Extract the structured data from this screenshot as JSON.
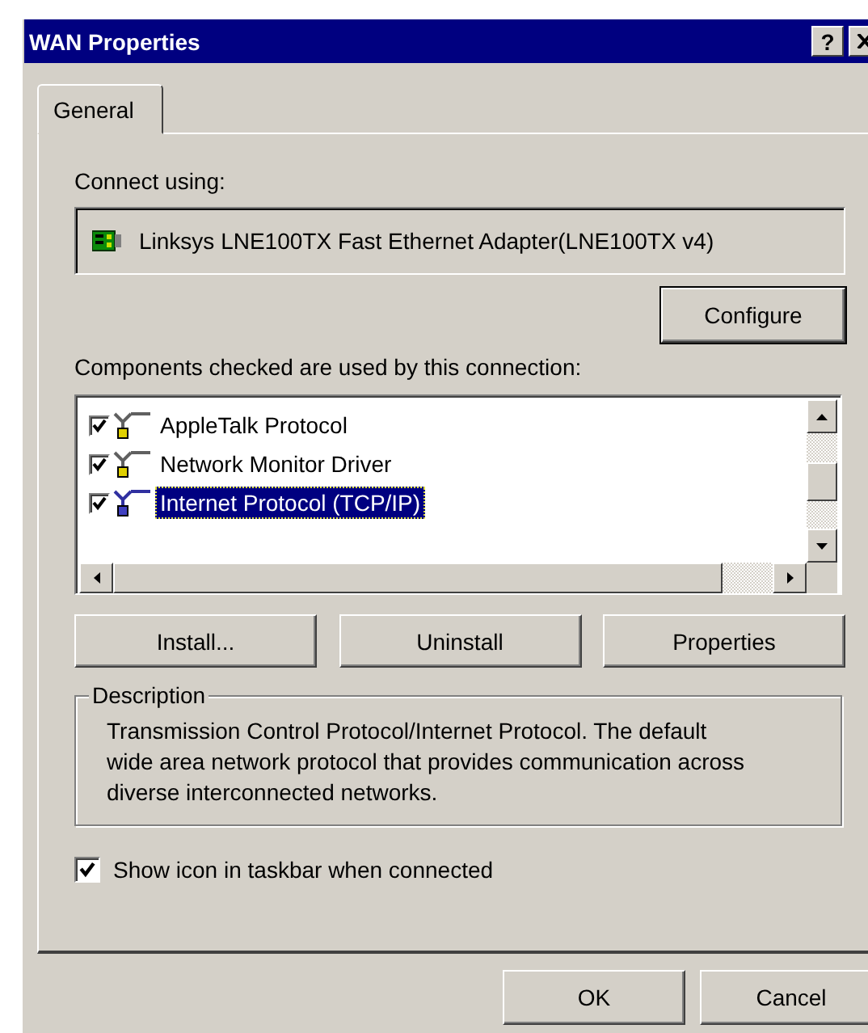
{
  "window": {
    "title": "WAN Properties",
    "title_buttons": [
      {
        "kind": "help",
        "label": "?"
      },
      {
        "kind": "close"
      }
    ]
  },
  "tabs": [
    {
      "label": "General",
      "selected": true
    }
  ],
  "connect_using": {
    "label": "Connect using:",
    "adapter": "Linksys LNE100TX Fast Ethernet Adapter(LNE100TX v4)"
  },
  "configure_button": "Configure",
  "components": {
    "label": "Components checked are used by this connection:",
    "items": [
      {
        "label": "AppleTalk Protocol",
        "checked": true,
        "selected": false
      },
      {
        "label": "Network Monitor Driver",
        "checked": true,
        "selected": false
      },
      {
        "label": "Internet Protocol (TCP/IP)",
        "checked": true,
        "selected": true
      }
    ]
  },
  "component_buttons": [
    "Install...",
    "Uninstall",
    "Properties"
  ],
  "description": {
    "title": "Description",
    "text": "Transmission Control Protocol/Internet Protocol. The default wide area network protocol that provides communication across diverse interconnected networks."
  },
  "show_icon": {
    "label": "Show icon in taskbar when connected",
    "checked": true
  },
  "footer_buttons": [
    "OK",
    "Cancel"
  ]
}
